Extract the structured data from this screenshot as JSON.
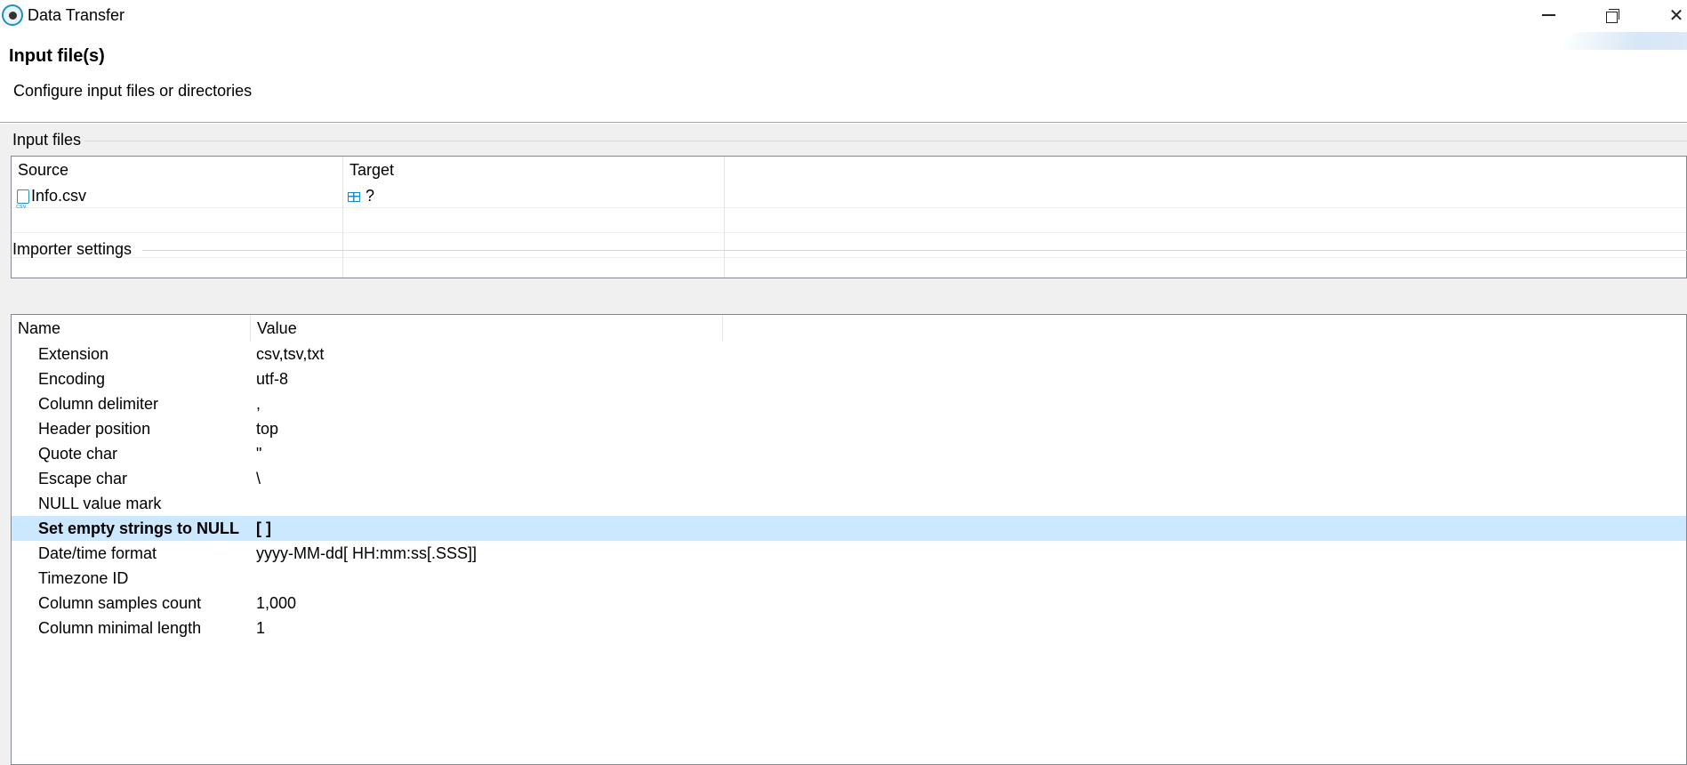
{
  "window": {
    "title": "Data Transfer",
    "app_icon": "dbeaver-beaver-icon",
    "controls": [
      "minimize-icon",
      "restore-icon",
      "close-icon"
    ]
  },
  "header": {
    "title": "Input file(s)",
    "description": "Configure input files or directories"
  },
  "input_files": {
    "group_label": "Input files",
    "columns": [
      "Source",
      "Target"
    ],
    "rows": [
      {
        "source": "Info.csv",
        "source_icon": "csv-file-icon",
        "target": "?",
        "target_icon": "table-icon"
      }
    ]
  },
  "importer_settings": {
    "group_label": "Importer settings",
    "columns": [
      "Name",
      "Value"
    ],
    "rows": [
      {
        "name": "Extension",
        "value": "csv,tsv,txt"
      },
      {
        "name": "Encoding",
        "value": "utf-8"
      },
      {
        "name": "Column delimiter",
        "value": ","
      },
      {
        "name": "Header position",
        "value": "top"
      },
      {
        "name": "Quote char",
        "value": "\""
      },
      {
        "name": "Escape char",
        "value": "\\"
      },
      {
        "name": "NULL value mark",
        "value": ""
      },
      {
        "name": "Set empty strings to NULL",
        "value": "[  ]",
        "selected": true
      },
      {
        "name": "Date/time format",
        "value": "yyyy-MM-dd[ HH:mm:ss[.SSS]]"
      },
      {
        "name": "Timezone ID",
        "value": ""
      },
      {
        "name": "Column samples count",
        "value": "1,000"
      },
      {
        "name": "Column minimal length",
        "value": "1"
      }
    ]
  },
  "colors": {
    "selection": "#cce8ff",
    "panel_background": "#f0f0f0",
    "border": "#828790",
    "accent": "#1b8ad3"
  }
}
